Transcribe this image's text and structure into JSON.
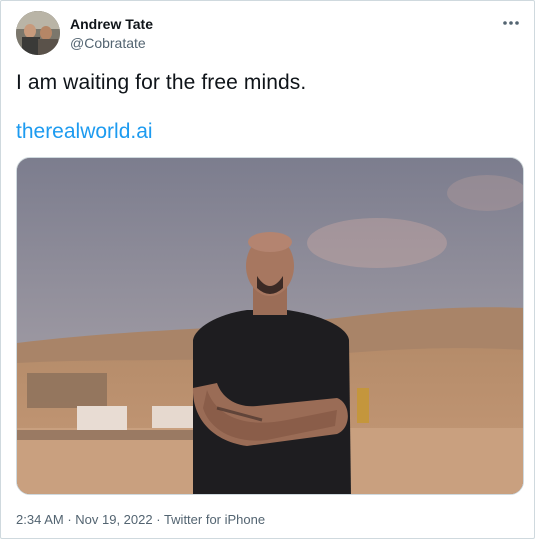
{
  "author": {
    "name": "Andrew Tate",
    "handle": "@Cobratate",
    "avatar_icon": "profile-avatar"
  },
  "menu": {
    "icon": "more-horizontal-icon"
  },
  "tweet": {
    "text": "I am waiting for the free minds.",
    "link": "therealworld.ai"
  },
  "media": {
    "description_icon": "photo-man-desert-arms-crossed"
  },
  "meta": {
    "time": "2:34 AM",
    "date": "Nov 19, 2022",
    "source": "Twitter for iPhone",
    "separator": " · "
  },
  "colors": {
    "text": "#0f1419",
    "secondary": "#536471",
    "link": "#1d9bf0",
    "border": "#cfd9de"
  }
}
